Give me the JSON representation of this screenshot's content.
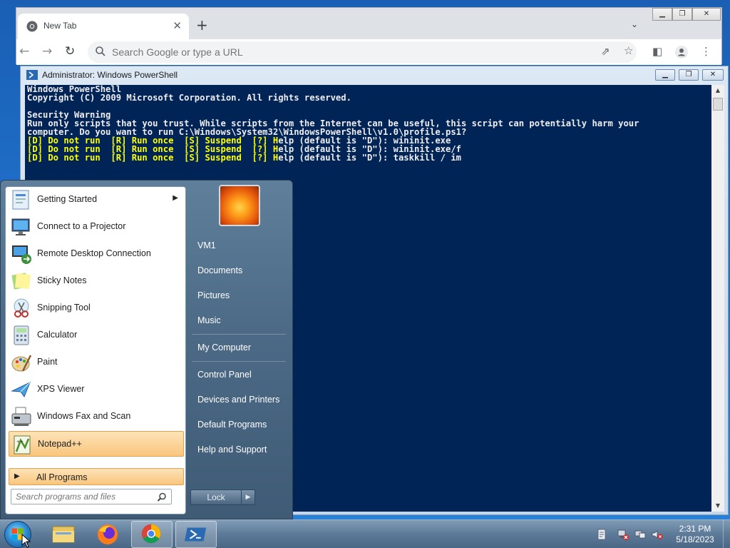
{
  "chrome": {
    "tab_title": "New Tab",
    "address_placeholder": "Search Google or type a URL",
    "icons": [
      "back-icon",
      "forward-icon",
      "reload-icon",
      "search-icon",
      "share-icon",
      "bookmark-star-icon",
      "side-panel-icon",
      "profile-icon",
      "menu-icon"
    ]
  },
  "powershell": {
    "title": "Administrator: Windows PowerShell",
    "lines": [
      {
        "text": "Windows PowerShell",
        "color": "white"
      },
      {
        "text": "Copyright (C) 2009 Microsoft Corporation. All rights reserved.",
        "color": "white"
      },
      {
        "text": "",
        "color": "white"
      },
      {
        "text": "Security Warning",
        "color": "white"
      },
      {
        "text": "Run only scripts that you trust. While scripts from the Internet can be useful, this script can potentially harm your",
        "color": "white"
      },
      {
        "text": "computer. Do you want to run C:\\Windows\\System32\\WindowsPowerShell\\v1.0\\profile.ps1?",
        "color": "white"
      },
      {
        "text": "[D] Do not run  [R] Run once  [S] Suspend  [?] Help (default is \"D\"): wininit.exe",
        "color": "yellow",
        "split": 48
      },
      {
        "text": "[D] Do not run  [R] Run once  [S] Suspend  [?] Help (default is \"D\"): wininit.exe/f",
        "color": "yellow",
        "split": 48
      },
      {
        "text": "[D] Do not run  [R] Run once  [S] Suspend  [?] Help (default is \"D\"): taskkill / im",
        "color": "yellow",
        "split": 48
      }
    ]
  },
  "start_menu": {
    "programs": [
      {
        "label": "Getting Started",
        "has_submenu": true
      },
      {
        "label": "Connect to a Projector"
      },
      {
        "label": "Remote Desktop Connection"
      },
      {
        "label": "Sticky Notes"
      },
      {
        "label": "Snipping Tool"
      },
      {
        "label": "Calculator"
      },
      {
        "label": "Paint"
      },
      {
        "label": "XPS Viewer"
      },
      {
        "label": "Windows Fax and Scan"
      },
      {
        "label": "Notepad++",
        "highlighted": true
      }
    ],
    "all_programs": "All Programs",
    "search_placeholder": "Search programs and files",
    "right_items": [
      "VM1",
      "Documents",
      "Pictures",
      "Music",
      "My Computer",
      "Control Panel",
      "Devices and Printers",
      "Default Programs",
      "Help and Support"
    ],
    "lock_label": "Lock"
  },
  "taskbar": {
    "apps": [
      "file-explorer-icon",
      "firefox-icon",
      "chrome-icon",
      "powershell-icon"
    ],
    "time": "2:31 PM",
    "date": "5/18/2023"
  },
  "colors": {
    "console_bg": "#012456",
    "console_text": "#eeedf0",
    "console_prompt": "#ffff00",
    "highlight": "#f9c67e"
  }
}
